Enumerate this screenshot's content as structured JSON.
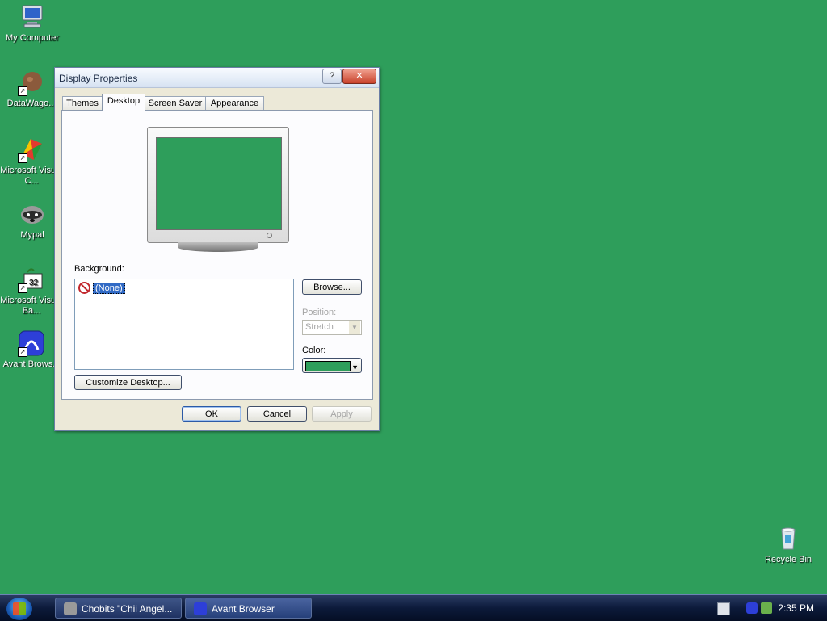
{
  "desktop": {
    "background_color": "#2e9e5b",
    "icons": [
      {
        "label": "My Computer",
        "icon": "computer-icon"
      },
      {
        "label": "DataWago...",
        "icon": "datawagon-icon"
      },
      {
        "label": "Microsoft Visual C...",
        "icon": "visual-c-icon"
      },
      {
        "label": "Mypal",
        "icon": "mypal-icon"
      },
      {
        "label": "Microsoft Visual Ba...",
        "icon": "visual-basic-icon"
      },
      {
        "label": "Avant Brows...",
        "icon": "avant-browser-icon"
      },
      {
        "label": "Recycle Bin",
        "icon": "recycle-bin-icon"
      }
    ]
  },
  "dialog": {
    "title": "Display Properties",
    "help_button": "?",
    "close_button": "✕",
    "tabs": [
      {
        "label": "Themes",
        "active": false
      },
      {
        "label": "Desktop",
        "active": true
      },
      {
        "label": "Screen Saver",
        "active": false
      },
      {
        "label": "Appearance",
        "active": false
      }
    ],
    "background_label": "Background:",
    "background_items": [
      "(None)"
    ],
    "browse_button": "Browse...",
    "position_label": "Position:",
    "position_value": "Stretch",
    "color_label": "Color:",
    "color_value": "#2e9e5b",
    "customize_button": "Customize Desktop...",
    "ok_button": "OK",
    "cancel_button": "Cancel",
    "apply_button": "Apply"
  },
  "taskbar": {
    "tasks": [
      {
        "label": "Chobits \"Chii Angel...",
        "icon": "mypal-icon"
      },
      {
        "label": "Avant Browser",
        "icon": "avant-browser-icon"
      }
    ],
    "clock": "2:35 PM"
  }
}
